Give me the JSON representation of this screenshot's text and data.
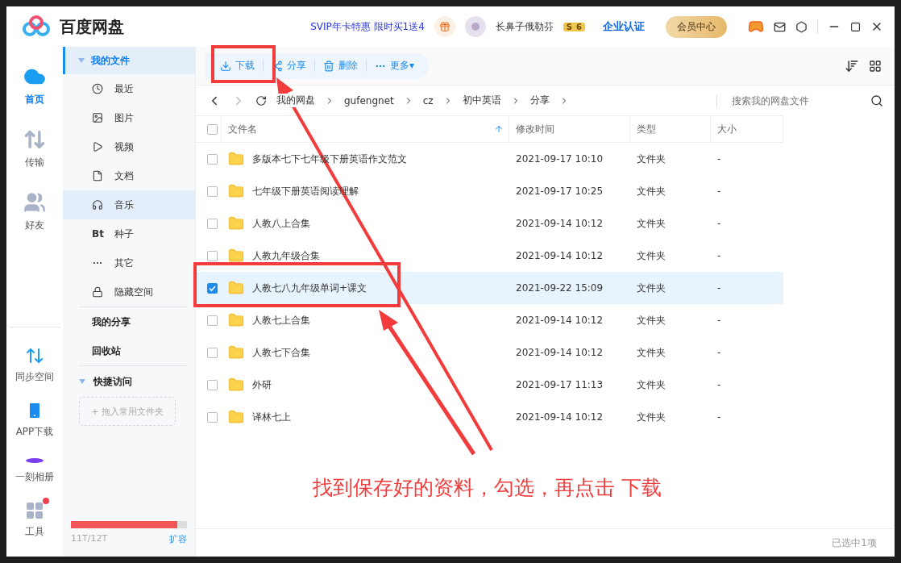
{
  "app": {
    "title": "百度网盘",
    "promo": "SVIP年卡特惠 限时买1送4",
    "user": "长鼻子俄勒芬",
    "level_badge": [
      "S",
      "6"
    ],
    "enterprise": "企业认证",
    "member_button": "会员中心"
  },
  "nav": [
    {
      "label": "首页",
      "kind": "home",
      "selected": true
    },
    {
      "label": "传输",
      "kind": "transfer",
      "selected": false
    },
    {
      "label": "好友",
      "kind": "friends",
      "selected": false
    }
  ],
  "nav_bottom": [
    {
      "label": "同步空间",
      "kind": "sync",
      "badge": false
    },
    {
      "label": "APP下载",
      "kind": "phone",
      "badge": false
    },
    {
      "label": "一刻相册",
      "kind": "album",
      "badge": false
    },
    {
      "label": "工具",
      "kind": "tools",
      "badge": true
    }
  ],
  "sidebar": {
    "header": {
      "label": "我的文件",
      "selected": true,
      "expanded": true
    },
    "items": [
      {
        "label": "最近",
        "kind": "recent",
        "highlighted": false
      },
      {
        "label": "图片",
        "kind": "image",
        "highlighted": false
      },
      {
        "label": "视频",
        "kind": "video",
        "highlighted": false
      },
      {
        "label": "文档",
        "kind": "doc",
        "highlighted": false
      },
      {
        "label": "音乐",
        "kind": "music",
        "highlighted": true
      },
      {
        "label": "种子",
        "kind": "text",
        "icon_text": "Bt",
        "highlighted": false
      },
      {
        "label": "其它",
        "kind": "other",
        "highlighted": false
      },
      {
        "label": "隐藏空间",
        "kind": "lock",
        "highlighted": false
      }
    ],
    "links": [
      "我的分享",
      "回收站"
    ],
    "quick": {
      "label": "快捷访问",
      "expanded": true,
      "drop_hint": "+ 拖入常用文件夹"
    },
    "storage": {
      "level": 0.92,
      "text": "11T/12T",
      "action": "扩容"
    }
  },
  "toolbar": [
    {
      "label": "下载",
      "kind": "download"
    },
    {
      "label": "分享",
      "kind": "share"
    },
    {
      "label": "删除",
      "kind": "delete"
    },
    {
      "label": "更多▾",
      "kind": "more"
    }
  ],
  "breadcrumb": [
    "我的网盘",
    "gufengnet",
    "cz",
    "初中英语",
    "分享"
  ],
  "search": {
    "placeholder": "搜索我的网盘文件"
  },
  "table": {
    "select_all": {
      "checked": false
    },
    "columns": [
      "文件名",
      "修改时间",
      "类型",
      "大小"
    ],
    "rows": [
      {
        "name": "多版本七下七年级下册英语作文范文",
        "time": "2021-09-17 10:10",
        "type": "文件夹",
        "size": "-",
        "selected": false
      },
      {
        "name": "七年级下册英语阅读理解",
        "time": "2021-09-17 10:25",
        "type": "文件夹",
        "size": "-",
        "selected": false
      },
      {
        "name": "人教八上合集",
        "time": "2021-09-14 10:12",
        "type": "文件夹",
        "size": "-",
        "selected": false
      },
      {
        "name": "人教九年级合集",
        "time": "2021-09-14 10:12",
        "type": "文件夹",
        "size": "-",
        "selected": false
      },
      {
        "name": "人教七八九年级单词+课文",
        "time": "2021-09-22 15:09",
        "type": "文件夹",
        "size": "-",
        "selected": true
      },
      {
        "name": "人教七上合集",
        "time": "2021-09-14 10:12",
        "type": "文件夹",
        "size": "-",
        "selected": false
      },
      {
        "name": "人教七下合集",
        "time": "2021-09-14 10:12",
        "type": "文件夹",
        "size": "-",
        "selected": false
      },
      {
        "name": "外研",
        "time": "2021-09-17 11:13",
        "type": "文件夹",
        "size": "-",
        "selected": false
      },
      {
        "name": "译林七上",
        "time": "2021-09-14 10:12",
        "type": "文件夹",
        "size": "-",
        "selected": false
      }
    ]
  },
  "status": "已选中1项",
  "annotation": {
    "text": "找到保存好的资料，勾选，再点击 下载"
  }
}
